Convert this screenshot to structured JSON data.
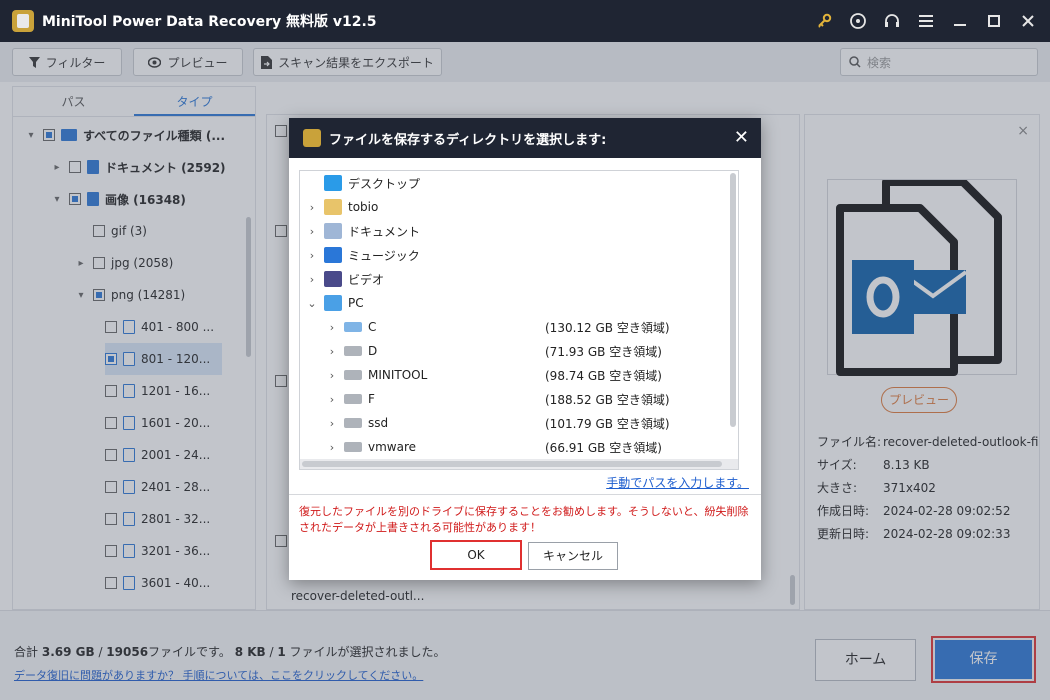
{
  "app": {
    "title": "MiniTool Power Data Recovery 無料版 v12.5"
  },
  "toolbar": {
    "filter_label": "フィルター",
    "preview_label": "プレビュー",
    "export_label": "スキャン結果をエクスポート",
    "search_placeholder": "検索"
  },
  "tabs": [
    "パス",
    "タイプ"
  ],
  "tree": [
    {
      "label": "すべてのファイル種類 (...",
      "level": 0,
      "expanded": true,
      "state": "partial",
      "icon": "monitor-icon"
    },
    {
      "label": "ドキュメント (2592)",
      "level": 1,
      "expanded": false,
      "state": "unchecked",
      "icon": "document-icon"
    },
    {
      "label": "画像 (16348)",
      "level": 1,
      "expanded": true,
      "state": "partial",
      "icon": "image-icon"
    },
    {
      "label": "gif (3)",
      "level": 2,
      "expanded": null,
      "state": "unchecked",
      "icon": ""
    },
    {
      "label": "jpg (2058)",
      "level": 2,
      "expanded": false,
      "state": "unchecked",
      "icon": ""
    },
    {
      "label": "png (14281)",
      "level": 2,
      "expanded": true,
      "state": "partial",
      "icon": ""
    },
    {
      "label": "401 - 800 ...",
      "level": 3,
      "state": "unchecked",
      "icon": "file-icon"
    },
    {
      "label": "801 - 120...",
      "level": 3,
      "state": "checked",
      "icon": "file-icon",
      "selected": true
    },
    {
      "label": "1201 - 16...",
      "level": 3,
      "state": "unchecked",
      "icon": "file-icon"
    },
    {
      "label": "1601 - 20...",
      "level": 3,
      "state": "unchecked",
      "icon": "file-icon"
    },
    {
      "label": "2001 - 24...",
      "level": 3,
      "state": "unchecked",
      "icon": "file-icon"
    },
    {
      "label": "2401 - 28...",
      "level": 3,
      "state": "unchecked",
      "icon": "file-icon"
    },
    {
      "label": "2801 - 32...",
      "level": 3,
      "state": "unchecked",
      "icon": "file-icon"
    },
    {
      "label": "3201 - 36...",
      "level": 3,
      "state": "unchecked",
      "icon": "file-icon"
    },
    {
      "label": "3601 - 40...",
      "level": 3,
      "state": "unchecked",
      "icon": "file-icon"
    }
  ],
  "center": {
    "file_caption": "recover-deleted-outl..."
  },
  "preview_panel": {
    "preview_button": "プレビュー",
    "info": [
      {
        "key": "ファイル名:",
        "value": "recover-deleted-outlook-fi"
      },
      {
        "key": "サイズ:",
        "value": "8.13 KB"
      },
      {
        "key": "大きさ:",
        "value": "371x402"
      },
      {
        "key": "作成日時:",
        "value": "2024-02-28 09:02:52"
      },
      {
        "key": "更新日時:",
        "value": "2024-02-28 09:02:33"
      }
    ]
  },
  "status": {
    "summary_prefix": "合計",
    "total_size": "3.69 GB",
    "total_files": "19056",
    "summary_mid": "ファイルです。",
    "sel_size": "8 KB",
    "sel_count": "1",
    "summary_suffix": "ファイルが選択されました。",
    "help_link": "データ復旧に問題がありますか？ 手順については、ここをクリックしてください。",
    "home_button": "ホーム",
    "save_button": "保存"
  },
  "dialog": {
    "title": "ファイルを保存するディレクトリを選択します:",
    "items": [
      {
        "label": "デスクトップ",
        "level": 0,
        "chevron": "",
        "icon": "desktop-icon",
        "free": ""
      },
      {
        "label": "tobio",
        "level": 0,
        "chevron": ">",
        "icon": "user-folder-icon",
        "free": ""
      },
      {
        "label": "ドキュメント",
        "level": 0,
        "chevron": ">",
        "icon": "documents-icon",
        "free": ""
      },
      {
        "label": "ミュージック",
        "level": 0,
        "chevron": ">",
        "icon": "music-icon",
        "free": ""
      },
      {
        "label": "ビデオ",
        "level": 0,
        "chevron": ">",
        "icon": "video-icon",
        "free": ""
      },
      {
        "label": "PC",
        "level": 0,
        "chevron": "v",
        "icon": "pc-icon",
        "free": ""
      },
      {
        "label": "C",
        "level": 1,
        "chevron": ">",
        "icon": "windows-drive-icon",
        "free": "(130.12 GB 空き領域)"
      },
      {
        "label": "D",
        "level": 1,
        "chevron": ">",
        "icon": "drive-icon",
        "free": "(71.93 GB 空き領域)"
      },
      {
        "label": "MINITOOL",
        "level": 1,
        "chevron": ">",
        "icon": "drive-icon",
        "free": "(98.74 GB 空き領域)"
      },
      {
        "label": "F",
        "level": 1,
        "chevron": ">",
        "icon": "drive-icon",
        "free": "(188.52 GB 空き領域)"
      },
      {
        "label": "ssd",
        "level": 1,
        "chevron": ">",
        "icon": "drive-icon",
        "free": "(101.79 GB 空き領域)"
      },
      {
        "label": "vmware",
        "level": 1,
        "chevron": ">",
        "icon": "drive-icon",
        "free": "(66.91 GB 空き領域)"
      }
    ],
    "manual_link": "手動でパスを入力します。",
    "warning": "復元したファイルを別のドライブに保存することをお勧めします。そうしないと、紛失削除されたデータが上書きされる可能性があります！",
    "ok_label": "OK",
    "cancel_label": "キャンセル"
  },
  "colors": {
    "accent": "#2a77d8",
    "titlebar": "#1f2533",
    "warning": "#d01a1a",
    "highlight": "#e03030",
    "outlook": "#0f62ac"
  }
}
